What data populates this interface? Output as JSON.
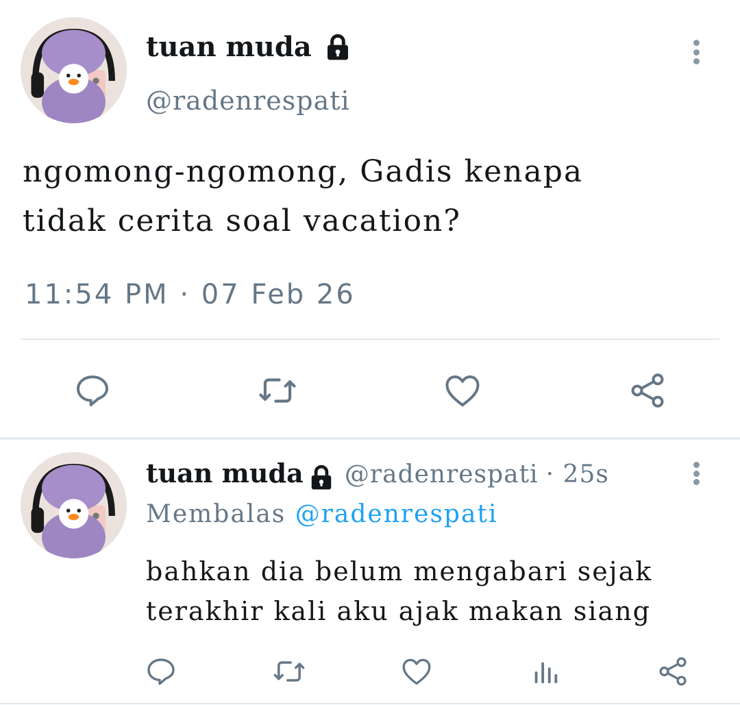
{
  "colors": {
    "text": "#14171a",
    "secondary": "#657786",
    "icon": "#657786",
    "link": "#1da1f2",
    "divider": "#e1e8ed"
  },
  "main_tweet": {
    "display_name": "tuan muda",
    "handle": "@radenrespati",
    "text_line1": "ngomong-ngomong, Gadis kenapa",
    "text_line2": "tidak cerita soal vacation?",
    "timestamp": "11:54 PM · 07 Feb 26",
    "actions": [
      "reply-icon",
      "retweet-icon",
      "like-icon",
      "share-icon"
    ]
  },
  "reply_tweet": {
    "display_name": "tuan muda",
    "handle": "@radenrespati",
    "time_ago": "· 25s",
    "replying_label": "Membalas",
    "replying_to": "@radenrespati",
    "text_line1": "bahkan dia belum mengabari sejak",
    "text_line2": "terakhir kali aku ajak makan siang",
    "actions": [
      "reply-icon",
      "retweet-icon",
      "like-icon",
      "analytics-icon",
      "share-icon"
    ]
  }
}
